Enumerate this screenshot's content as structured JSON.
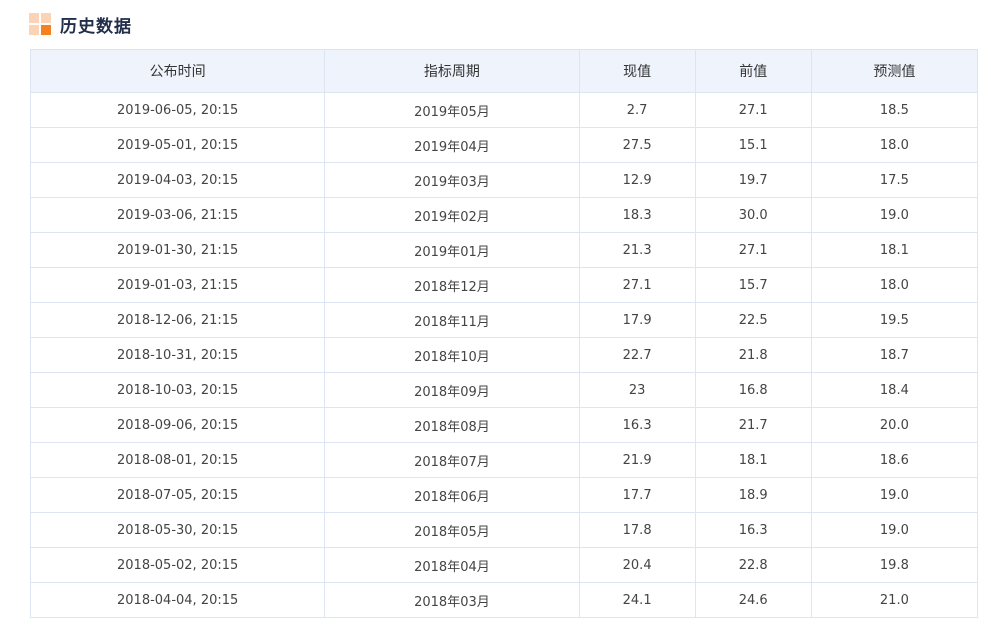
{
  "section": {
    "title": "历史数据",
    "icon": "grid-logo-icon",
    "accent_color": "#f5801f",
    "icon_light_color": "#fcd3b4"
  },
  "table": {
    "header_bg": "#eef3fc",
    "border_color": "#dde5f2",
    "columns": [
      "公布时间",
      "指标周期",
      "现值",
      "前值",
      "预测值"
    ],
    "rows": [
      [
        "2019-06-05, 20:15",
        "2019年05月",
        "2.7",
        "27.1",
        "18.5"
      ],
      [
        "2019-05-01, 20:15",
        "2019年04月",
        "27.5",
        "15.1",
        "18.0"
      ],
      [
        "2019-04-03, 20:15",
        "2019年03月",
        "12.9",
        "19.7",
        "17.5"
      ],
      [
        "2019-03-06, 21:15",
        "2019年02月",
        "18.3",
        "30.0",
        "19.0"
      ],
      [
        "2019-01-30, 21:15",
        "2019年01月",
        "21.3",
        "27.1",
        "18.1"
      ],
      [
        "2019-01-03, 21:15",
        "2018年12月",
        "27.1",
        "15.7",
        "18.0"
      ],
      [
        "2018-12-06, 21:15",
        "2018年11月",
        "17.9",
        "22.5",
        "19.5"
      ],
      [
        "2018-10-31, 20:15",
        "2018年10月",
        "22.7",
        "21.8",
        "18.7"
      ],
      [
        "2018-10-03, 20:15",
        "2018年09月",
        "23",
        "16.8",
        "18.4"
      ],
      [
        "2018-09-06, 20:15",
        "2018年08月",
        "16.3",
        "21.7",
        "20.0"
      ],
      [
        "2018-08-01, 20:15",
        "2018年07月",
        "21.9",
        "18.1",
        "18.6"
      ],
      [
        "2018-07-05, 20:15",
        "2018年06月",
        "17.7",
        "18.9",
        "19.0"
      ],
      [
        "2018-05-30, 20:15",
        "2018年05月",
        "17.8",
        "16.3",
        "19.0"
      ],
      [
        "2018-05-02, 20:15",
        "2018年04月",
        "20.4",
        "22.8",
        "19.8"
      ],
      [
        "2018-04-04, 20:15",
        "2018年03月",
        "24.1",
        "24.6",
        "21.0"
      ]
    ]
  }
}
